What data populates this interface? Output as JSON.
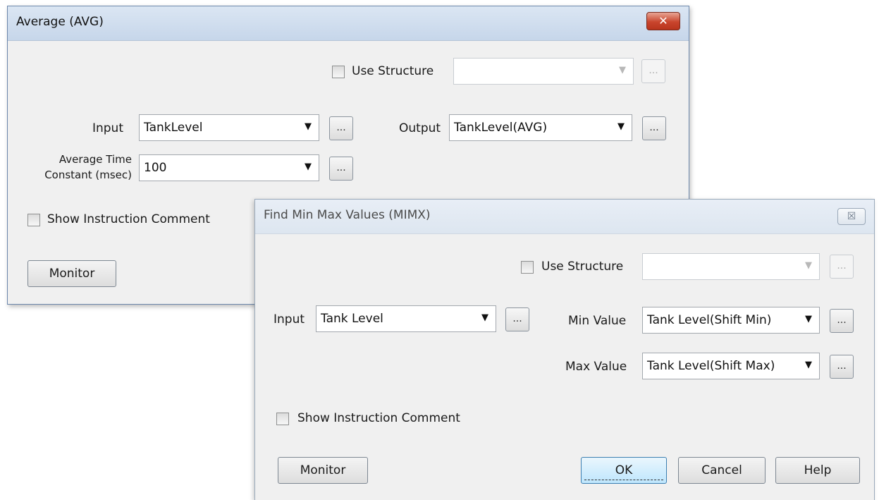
{
  "avg_dialog": {
    "title": "Average (AVG)",
    "close": "✕",
    "use_structure_label": "Use Structure",
    "use_structure_value": "",
    "input_label": "Input",
    "input_value": "TankLevel",
    "output_label": "Output",
    "output_value": "TankLevel(AVG)",
    "avg_time_label_line1": "Average Time",
    "avg_time_label_line2": "Constant (msec)",
    "avg_time_value": "100",
    "show_comment_label": "Show Instruction Comment",
    "monitor_label": "Monitor",
    "browse": "..."
  },
  "mimx_dialog": {
    "title": "Find Min Max Values (MIMX)",
    "close": "☒",
    "use_structure_label": "Use Structure",
    "use_structure_value": "",
    "input_label": "Input",
    "input_value": "Tank Level",
    "min_label": "Min Value",
    "min_value": "Tank Level(Shift Min)",
    "max_label": "Max Value",
    "max_value": "Tank Level(Shift Max)",
    "show_comment_label": "Show Instruction Comment",
    "monitor_label": "Monitor",
    "ok_label": "OK",
    "cancel_label": "Cancel",
    "help_label": "Help",
    "browse": "..."
  },
  "icons": {
    "dropdown": "chevron-down-icon"
  }
}
